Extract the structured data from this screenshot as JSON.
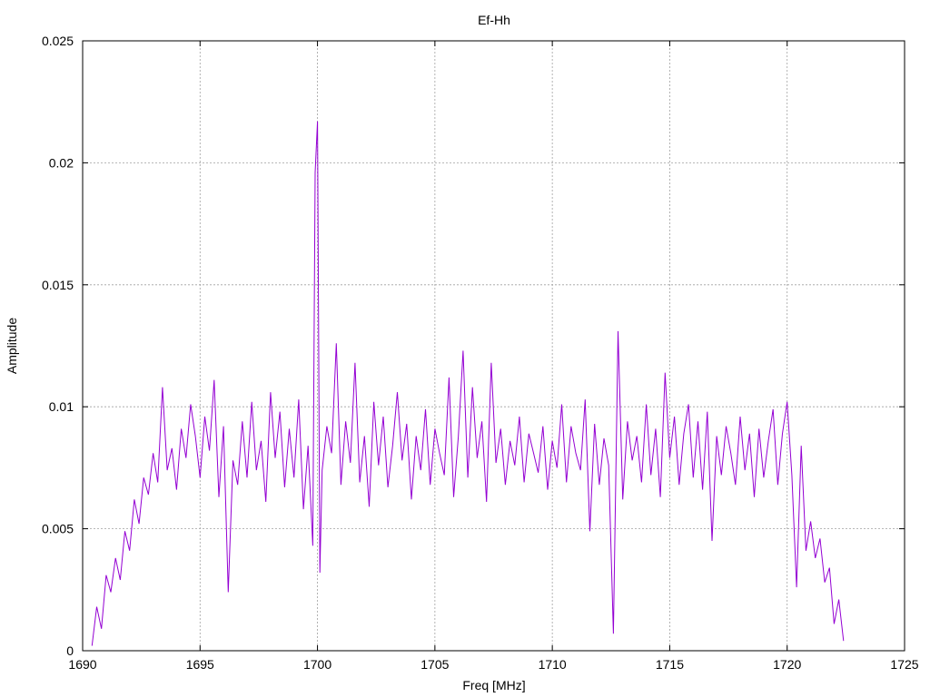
{
  "chart_data": {
    "type": "line",
    "title": "Ef-Hh",
    "xlabel": "Freq [MHz]",
    "ylabel": "Amplitude",
    "xlim": [
      1690,
      1725
    ],
    "ylim": [
      0,
      0.025
    ],
    "xticks": [
      1690,
      1695,
      1700,
      1705,
      1710,
      1715,
      1720,
      1725
    ],
    "xtick_labels": [
      "1690",
      "1695",
      "1700",
      "1705",
      "1710",
      "1715",
      "1720",
      "1725"
    ],
    "yticks": [
      0,
      0.005,
      0.01,
      0.015,
      0.02,
      0.025
    ],
    "ytick_labels": [
      "0",
      "0.005",
      "0.01",
      "0.015",
      "0.02",
      "0.025"
    ],
    "grid": true,
    "color": "#9400d3",
    "series": [
      {
        "x": [
          1690.4,
          1690.6,
          1690.8,
          1691.0,
          1691.2,
          1691.4,
          1691.6,
          1691.8,
          1692.0,
          1692.2,
          1692.4,
          1692.6,
          1692.8,
          1693.0,
          1693.2,
          1693.4,
          1693.6,
          1693.8,
          1694.0,
          1694.2,
          1694.4,
          1694.6,
          1694.8,
          1695.0,
          1695.2,
          1695.4,
          1695.6,
          1695.8,
          1696.0,
          1696.2,
          1696.4,
          1696.6,
          1696.8,
          1697.0,
          1697.2,
          1697.4,
          1697.6,
          1697.8,
          1698.0,
          1698.2,
          1698.4,
          1698.6,
          1698.8,
          1699.0,
          1699.2,
          1699.4,
          1699.6,
          1699.8,
          1699.9,
          1700.0,
          1700.1,
          1700.2,
          1700.4,
          1700.6,
          1700.8,
          1701.0,
          1701.2,
          1701.4,
          1701.6,
          1701.8,
          1702.0,
          1702.2,
          1702.4,
          1702.6,
          1702.8,
          1703.0,
          1703.2,
          1703.4,
          1703.6,
          1703.8,
          1704.0,
          1704.2,
          1704.4,
          1704.6,
          1704.8,
          1705.0,
          1705.2,
          1705.4,
          1705.6,
          1705.8,
          1706.0,
          1706.2,
          1706.4,
          1706.6,
          1706.8,
          1707.0,
          1707.2,
          1707.4,
          1707.6,
          1707.8,
          1708.0,
          1708.2,
          1708.4,
          1708.6,
          1708.8,
          1709.0,
          1709.2,
          1709.4,
          1709.6,
          1709.8,
          1710.0,
          1710.2,
          1710.4,
          1710.6,
          1710.8,
          1711.0,
          1711.2,
          1711.4,
          1711.6,
          1711.8,
          1712.0,
          1712.2,
          1712.4,
          1712.6,
          1712.8,
          1713.0,
          1713.2,
          1713.4,
          1713.6,
          1713.8,
          1714.0,
          1714.2,
          1714.4,
          1714.6,
          1714.8,
          1715.0,
          1715.2,
          1715.4,
          1715.6,
          1715.8,
          1716.0,
          1716.2,
          1716.4,
          1716.6,
          1716.8,
          1717.0,
          1717.2,
          1717.4,
          1717.6,
          1717.8,
          1718.0,
          1718.2,
          1718.4,
          1718.6,
          1718.8,
          1719.0,
          1719.2,
          1719.4,
          1719.6,
          1719.8,
          1720.0,
          1720.2,
          1720.4,
          1720.6,
          1720.8,
          1721.0,
          1721.2,
          1721.4,
          1721.6,
          1721.8,
          1722.0,
          1722.2,
          1722.4
        ],
        "y": [
          0.0002,
          0.0018,
          0.0009,
          0.0031,
          0.0024,
          0.0038,
          0.0029,
          0.0049,
          0.0041,
          0.0062,
          0.0052,
          0.0071,
          0.0064,
          0.0081,
          0.0069,
          0.0108,
          0.0074,
          0.0083,
          0.0066,
          0.0091,
          0.0079,
          0.0101,
          0.0088,
          0.0071,
          0.0096,
          0.0082,
          0.0111,
          0.0063,
          0.0092,
          0.0024,
          0.0078,
          0.0068,
          0.0094,
          0.0071,
          0.0102,
          0.0074,
          0.0086,
          0.0061,
          0.0106,
          0.0079,
          0.0098,
          0.0067,
          0.0091,
          0.0071,
          0.0103,
          0.0058,
          0.0084,
          0.0043,
          0.0196,
          0.0217,
          0.0032,
          0.0074,
          0.0092,
          0.0081,
          0.0126,
          0.0068,
          0.0094,
          0.0077,
          0.0118,
          0.0069,
          0.0088,
          0.0059,
          0.0102,
          0.0076,
          0.0096,
          0.0067,
          0.0084,
          0.0106,
          0.0078,
          0.0093,
          0.0062,
          0.0088,
          0.0074,
          0.0099,
          0.0068,
          0.0091,
          0.0081,
          0.0072,
          0.0112,
          0.0063,
          0.0088,
          0.0123,
          0.0071,
          0.0108,
          0.0079,
          0.0094,
          0.0061,
          0.0118,
          0.0077,
          0.0091,
          0.0068,
          0.0086,
          0.0076,
          0.0096,
          0.0069,
          0.0089,
          0.0081,
          0.0073,
          0.0092,
          0.0066,
          0.0086,
          0.0075,
          0.0101,
          0.0069,
          0.0092,
          0.0081,
          0.0074,
          0.0103,
          0.0049,
          0.0093,
          0.0068,
          0.0087,
          0.0076,
          0.0007,
          0.0131,
          0.0062,
          0.0094,
          0.0078,
          0.0088,
          0.0069,
          0.0101,
          0.0072,
          0.0091,
          0.0063,
          0.0114,
          0.0079,
          0.0096,
          0.0068,
          0.0089,
          0.0101,
          0.0071,
          0.0094,
          0.0066,
          0.0098,
          0.0045,
          0.0088,
          0.0072,
          0.0092,
          0.0081,
          0.0068,
          0.0096,
          0.0074,
          0.0089,
          0.0063,
          0.0091,
          0.0071,
          0.0086,
          0.0099,
          0.0068,
          0.0089,
          0.0102,
          0.0072,
          0.0026,
          0.0084,
          0.0041,
          0.0053,
          0.0038,
          0.0046,
          0.0028,
          0.0034,
          0.0011,
          0.0021,
          0.0004
        ]
      }
    ]
  }
}
